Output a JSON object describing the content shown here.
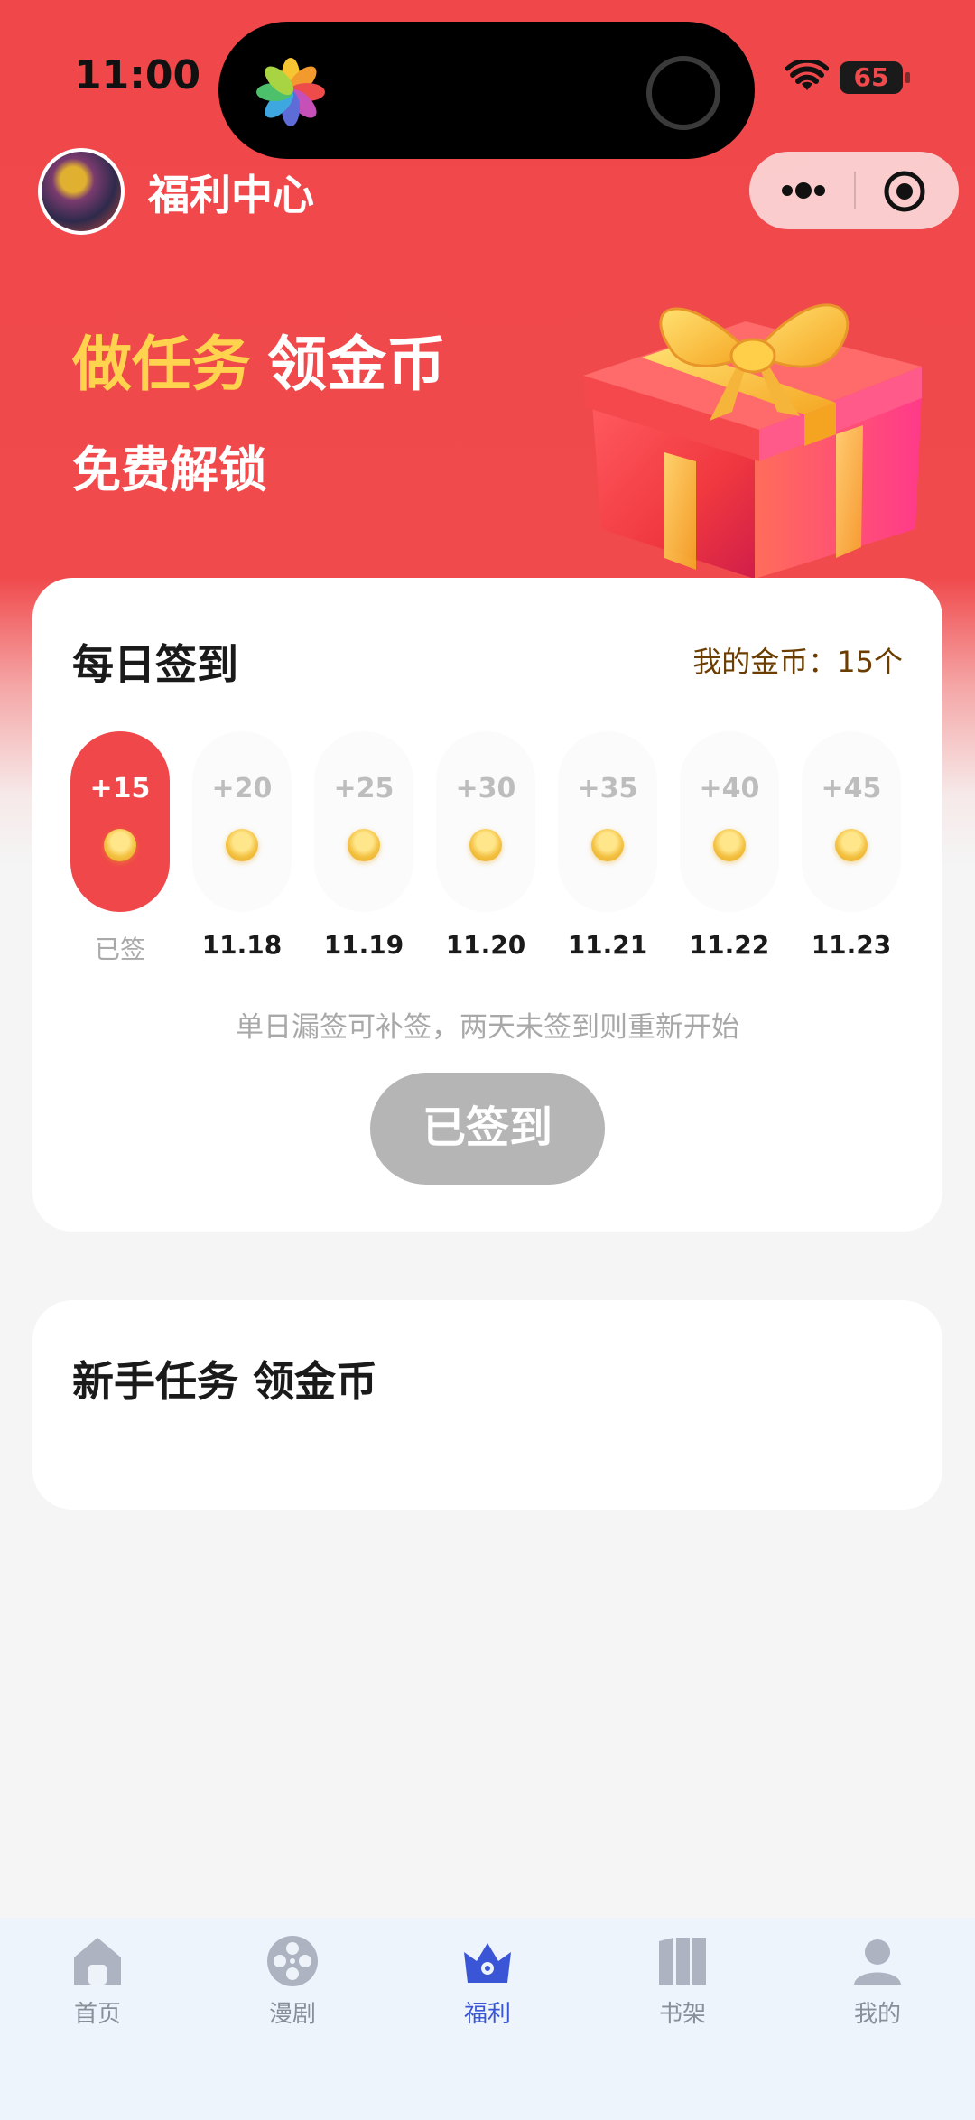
{
  "status_bar": {
    "time": "11:00",
    "battery": "65"
  },
  "header": {
    "title": "福利中心"
  },
  "hero": {
    "line1_highlight": "做任务",
    "line1_rest": "领金币",
    "line2": "免费解锁"
  },
  "signin": {
    "title": "每日签到",
    "coins_label": "我的金币：15个",
    "days": [
      {
        "amount": "+15",
        "date": "已签",
        "signed": true
      },
      {
        "amount": "+20",
        "date": "11.18",
        "signed": false
      },
      {
        "amount": "+25",
        "date": "11.19",
        "signed": false
      },
      {
        "amount": "+30",
        "date": "11.20",
        "signed": false
      },
      {
        "amount": "+35",
        "date": "11.21",
        "signed": false
      },
      {
        "amount": "+40",
        "date": "11.22",
        "signed": false
      },
      {
        "amount": "+45",
        "date": "11.23",
        "signed": false
      }
    ],
    "note": "单日漏签可补签，两天未签到则重新开始",
    "button_label": "已签到"
  },
  "tasks": {
    "title": "新手任务 领金币"
  },
  "tabbar": {
    "items": [
      {
        "label": "首页",
        "icon": "home-icon",
        "active": false
      },
      {
        "label": "漫剧",
        "icon": "film-reel-icon",
        "active": false
      },
      {
        "label": "福利",
        "icon": "crown-icon",
        "active": true
      },
      {
        "label": "书架",
        "icon": "bookshelf-icon",
        "active": false
      },
      {
        "label": "我的",
        "icon": "user-icon",
        "active": false
      }
    ]
  },
  "colors": {
    "primary_red": "#f0474a",
    "highlight_yellow": "#ffd34d",
    "tab_active": "#3a56d6",
    "tab_inactive": "#8a8e99",
    "button_disabled": "#b5b5b5"
  }
}
